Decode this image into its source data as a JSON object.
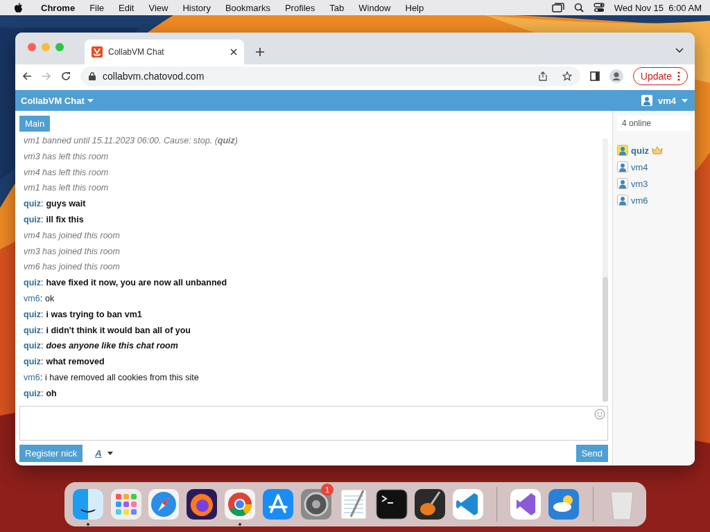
{
  "menubar": {
    "app": "Chrome",
    "items": [
      "File",
      "Edit",
      "View",
      "History",
      "Bookmarks",
      "Profiles",
      "Tab",
      "Window",
      "Help"
    ],
    "clock": "Wed Nov 15  6:00 AM"
  },
  "browser": {
    "tab": {
      "title": "CollabVM Chat",
      "selected": true
    },
    "url": "collabvm.chatovod.com",
    "update": "Update"
  },
  "app": {
    "title": "CollabVM Chat",
    "user": "vm4",
    "room_tab": {
      "label": "Main",
      "selected": true
    },
    "messages": [
      {
        "kind": "system",
        "text": "vm1 banned until 15.11.2023 06:00. Cause: stop. (**quiz**)"
      },
      {
        "kind": "system",
        "text": "vm3 has left this room"
      },
      {
        "kind": "system",
        "text": "vm4 has left this room"
      },
      {
        "kind": "system",
        "text": "vm1 has left this room"
      },
      {
        "kind": "chat",
        "nick": "quiz",
        "text": "guys wait",
        "bold": true,
        "italic": false
      },
      {
        "kind": "chat",
        "nick": "quiz",
        "text": "ill fix this",
        "bold": true,
        "italic": false
      },
      {
        "kind": "system",
        "text": "vm4 has joined this room"
      },
      {
        "kind": "system",
        "text": "vm3 has joined this room"
      },
      {
        "kind": "system",
        "text": "vm6 has joined this room"
      },
      {
        "kind": "chat",
        "nick": "quiz",
        "text": "have fixed it now, you are now all unbanned",
        "bold": true,
        "italic": false
      },
      {
        "kind": "chat",
        "nick": "vm6",
        "text": "ok",
        "bold": false,
        "italic": false
      },
      {
        "kind": "chat",
        "nick": "quiz",
        "text": "i was trying to ban vm1",
        "bold": true,
        "italic": false
      },
      {
        "kind": "chat",
        "nick": "quiz",
        "text": "i didn't think it would ban all of you",
        "bold": true,
        "italic": false
      },
      {
        "kind": "chat",
        "nick": "quiz",
        "text": "does anyone like this chat room",
        "bold": true,
        "italic": true
      },
      {
        "kind": "chat",
        "nick": "quiz",
        "text": "what removed",
        "bold": true,
        "italic": false
      },
      {
        "kind": "chat",
        "nick": "vm6",
        "text": "i have removed all cookies from this site",
        "bold": false,
        "italic": false
      },
      {
        "kind": "chat",
        "nick": "quiz",
        "text": "oh",
        "bold": true,
        "italic": false
      }
    ],
    "nick_separator": ":",
    "online_count": "4 online",
    "users": [
      {
        "name": "quiz",
        "owner": true
      },
      {
        "name": "vm4",
        "owner": false
      },
      {
        "name": "vm3",
        "owner": false
      },
      {
        "name": "vm6",
        "owner": false
      }
    ],
    "register_button": "Register nick",
    "font_button": "A",
    "send_button": "Send"
  },
  "dock": [
    {
      "kind": "finder",
      "running": true
    },
    {
      "kind": "launchpad",
      "running": false
    },
    {
      "kind": "safari",
      "running": false
    },
    {
      "kind": "firefox",
      "running": false
    },
    {
      "kind": "chrome",
      "running": true
    },
    {
      "kind": "appstore",
      "running": false
    },
    {
      "kind": "settings",
      "running": false,
      "badge": "1"
    },
    {
      "kind": "textedit",
      "running": false
    },
    {
      "kind": "terminal",
      "running": false
    },
    {
      "kind": "garageband",
      "running": false
    },
    {
      "kind": "vscode",
      "running": false
    },
    {
      "kind": "separator"
    },
    {
      "kind": "vstudio",
      "running": false
    },
    {
      "kind": "weather",
      "running": false
    },
    {
      "kind": "separator"
    },
    {
      "kind": "trash",
      "running": false
    }
  ]
}
